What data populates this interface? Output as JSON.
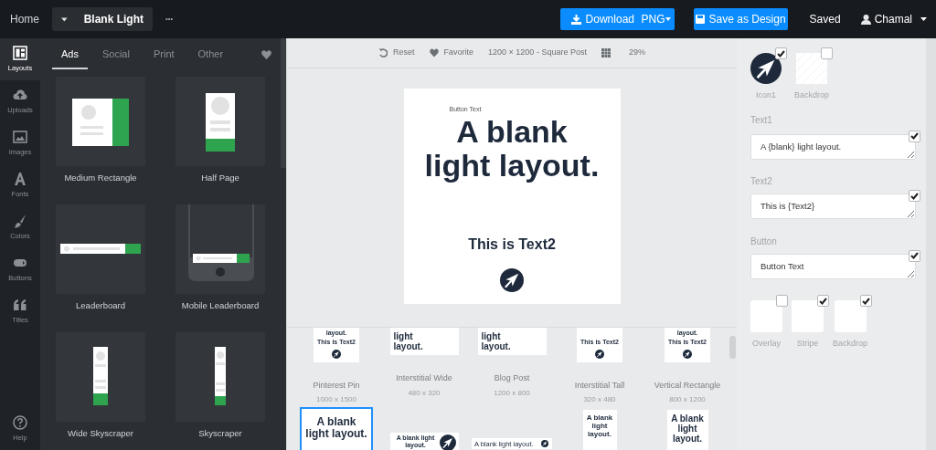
{
  "top_bar": {
    "home": "Home",
    "design_menu": "Blank Light",
    "more": "•••",
    "download": {
      "label": "Download",
      "format": "PNG"
    },
    "save": "Save as Design",
    "status": "Saved",
    "user": "Chamal"
  },
  "sidebar": {
    "items": [
      {
        "label": "Layouts",
        "selected": true
      },
      {
        "label": "Uploads",
        "selected": false
      },
      {
        "label": "Images",
        "selected": false
      },
      {
        "label": "Fonts",
        "selected": false
      },
      {
        "label": "Colors",
        "selected": false
      },
      {
        "label": "Buttons",
        "selected": false
      },
      {
        "label": "Titles",
        "selected": false
      }
    ],
    "help": "Help"
  },
  "layout_panel": {
    "tabs": [
      {
        "label": "Ads",
        "selected": true
      },
      {
        "label": "Social",
        "selected": false
      },
      {
        "label": "Print",
        "selected": false
      },
      {
        "label": "Other",
        "selected": false
      }
    ],
    "layouts": [
      {
        "title": "Medium Rectangle",
        "kind": "medium"
      },
      {
        "title": "Half Page",
        "kind": "half"
      },
      {
        "title": "Leaderboard",
        "kind": "leader"
      },
      {
        "title": "Mobile Leaderboard",
        "kind": "mobile"
      },
      {
        "title": "Wide Skyscraper",
        "kind": "wide"
      },
      {
        "title": "Skyscraper",
        "kind": "sky"
      }
    ]
  },
  "toolbar": {
    "reset": "Reset",
    "favorite": "Favorite",
    "size": "1200 × 1200 - Square Post",
    "zoom": "29%"
  },
  "canvas": {
    "button_text": "Button Text",
    "text1": "A blank light layout.",
    "text2": "This is Text2"
  },
  "gallery": {
    "items": [
      {
        "title": "Pinterest Pin",
        "size": "1000 x 1500",
        "selected": false,
        "kind": "tall",
        "texts": [
          "layout.",
          "This is Text2"
        ]
      },
      {
        "title": "Interstitial Wide",
        "size": "480 x 320",
        "selected": false,
        "kind": "wide",
        "texts": [
          "light",
          "layout."
        ]
      },
      {
        "title": "Blog Post",
        "size": "1200 x 800",
        "selected": false,
        "kind": "wide",
        "texts": [
          "light",
          "layout."
        ]
      },
      {
        "title": "Interstitial Tall",
        "size": "320 x 480",
        "selected": false,
        "kind": "tall",
        "texts": [
          "This is Text2"
        ]
      },
      {
        "title": "Vertical Rectangle",
        "size": "800 x 1200",
        "selected": false,
        "kind": "tall",
        "texts": [
          "layout.",
          "This is Text2"
        ]
      },
      {
        "selected": true,
        "kind": "square",
        "texts": [
          "A blank light layout."
        ]
      },
      {
        "selected": false,
        "kind": "banner",
        "texts": [
          "A blank light layout."
        ]
      },
      {
        "selected": false,
        "kind": "strip",
        "texts": [
          "A blank light layout."
        ]
      },
      {
        "selected": false,
        "kind": "narrow",
        "texts": [
          "A blank light layout."
        ]
      },
      {
        "selected": false,
        "kind": "portrait",
        "texts": [
          "A blank light layout."
        ]
      }
    ]
  },
  "properties": {
    "images": [
      {
        "label": "Icon1",
        "kind": "icon",
        "checked": true
      },
      {
        "label": "Backdrop",
        "kind": "pattern",
        "checked": false
      }
    ],
    "fields": [
      {
        "label": "Text1",
        "value": "A {blank} light layout.",
        "checked": true
      },
      {
        "label": "Text2",
        "value": "This is {Text2}",
        "checked": true
      },
      {
        "label": "Button",
        "value": "Button Text",
        "checked": true
      }
    ],
    "swatches": [
      {
        "label": "Overlay",
        "checked": false
      },
      {
        "label": "Stripe",
        "checked": true
      },
      {
        "label": "Backdrop",
        "checked": true
      }
    ]
  }
}
